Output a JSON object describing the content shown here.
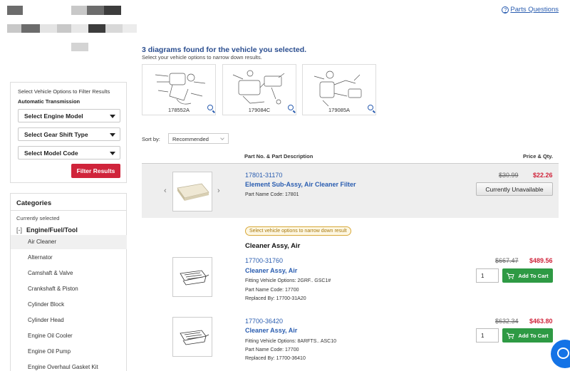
{
  "header": {
    "help_link": "Parts Questions",
    "help_icon": "question-circle-icon"
  },
  "filter": {
    "title": "Select Vehicle Options to Filter Results",
    "transmission": "Automatic Transmission",
    "engine_model": "Select Engine Model",
    "gear_shift": "Select Gear Shift Type",
    "model_code": "Select Model Code",
    "button": "Filter Results"
  },
  "categories": {
    "title": "Categories",
    "currently_selected": "Currently selected",
    "collapse": "[-]",
    "parent": "Engine/Fuel/Tool",
    "items": [
      "Air Cleaner",
      "Alternator",
      "Camshaft & Valve",
      "Crankshaft & Piston",
      "Cylinder Block",
      "Cylinder Head",
      "Engine Oil Cooler",
      "Engine Oil Pump",
      "Engine Overhaul Gasket Kit"
    ]
  },
  "main": {
    "heading": "3 diagrams found for the vehicle you selected.",
    "subheading": "Select your vehicle options to narrow down results.",
    "diagrams": [
      "178552A",
      "179084C",
      "179085A"
    ],
    "sort_label": "Sort by:",
    "sort_value": "Recommended",
    "col_desc": "Part No. & Part Description",
    "col_price": "Price & Qty."
  },
  "parts": [
    {
      "number": "17801-31170",
      "name": "Element Sub-Assy, Air Cleaner Filter",
      "meta1": "Part Name Code: 17801",
      "old_price": "$30.99",
      "new_price": "$22.26",
      "action": "Currently Unavailable"
    },
    {
      "number": "17700-31760",
      "name": "Cleaner Assy, Air",
      "meta1": "Fitting Vehicle Options: 2GRF.. GSC1#",
      "meta2": "Part Name Code: 17700",
      "meta3": "Replaced By: 17700-31A20",
      "old_price": "$667.47",
      "new_price": "$489.56",
      "qty": "1",
      "action": "Add To Cart"
    },
    {
      "number": "17700-36420",
      "name": "Cleaner Assy, Air",
      "meta1": "Fitting Vehicle Options: 8ARFTS.. ASC10",
      "meta2": "Part Name Code: 17700",
      "meta3": "Replaced By: 17700-36410",
      "old_price": "$632.34",
      "new_price": "$463.80",
      "qty": "1",
      "action": "Add To Cart"
    }
  ],
  "notice": "Select vehicle options to narrow down result",
  "group_title": "Cleaner Assy, Air",
  "colors": {
    "accent": "#2a5db0",
    "heading": "#2a4d8f",
    "sale": "#d0243b",
    "cart": "#2e9a44"
  }
}
